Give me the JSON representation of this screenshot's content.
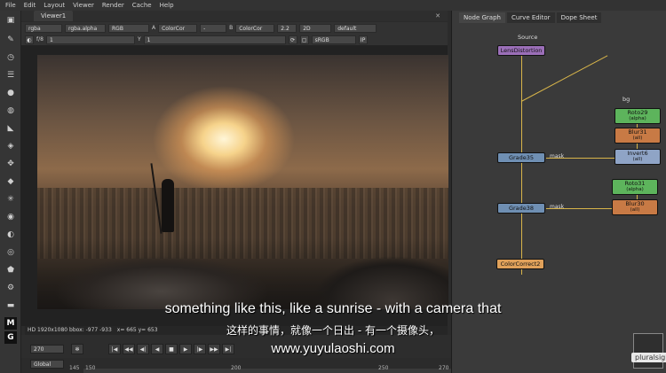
{
  "menu": [
    "File",
    "Edit",
    "Layout",
    "Viewer",
    "Render",
    "Cache",
    "Help"
  ],
  "viewer": {
    "tab_label": "Viewer1",
    "close_glyph": "✕",
    "channels": "rgba",
    "alpha_channel": "rgba.alpha",
    "display": "RGB",
    "a_label": "A",
    "a_input": "ColorCor",
    "dash": "-",
    "b_label": "B",
    "b_input": "ColorCor",
    "proxy": "2D",
    "gain_label": "2.2",
    "lut": "default",
    "f_label": "f/8",
    "f_value": "1",
    "y_label": "Y",
    "y_value": "1",
    "colorspace": "sRGB",
    "ip_label": "IP"
  },
  "status_line": {
    "format": "HD 1920x1080 bbox: -977 -933",
    "coords": "x= 665 y= 653"
  },
  "timeline": {
    "frame": "270",
    "scope": "Global",
    "ticks": [
      "145",
      "150",
      "200",
      "250",
      "270"
    ],
    "play_buttons": [
      "|◀",
      "◀◀",
      "◀|",
      "◀",
      "■",
      "▶",
      "|▶",
      "▶▶",
      "▶|"
    ]
  },
  "node_graph": {
    "tabs": [
      "Node Graph",
      "Curve Editor",
      "Dope Sheet"
    ],
    "source_label": "Source",
    "nodes": {
      "read": "LensDistortion",
      "grade35": "Grade35",
      "grade38": "Grade38",
      "colorcorrect": "ColorCorrect2",
      "roto29": "Roto29",
      "roto29_sub": "(alpha)",
      "blur31": "Blur31",
      "blur31_sub": "(all)",
      "invert6": "Invert6",
      "invert6_sub": "(all)",
      "roto31": "Roto31",
      "roto31_sub": "(alpha)",
      "blur30": "Blur30",
      "blur30_sub": "(all)"
    },
    "mask_label": "mask",
    "bg_label": "bg",
    "brand": "pluralsight"
  },
  "subtitles": {
    "english": "something like this, like a sunrise - with a camera that",
    "chinese": "这样的事情，就像一个日出 - 有一个摄像头，",
    "url": "www.yuyulaoshi.com"
  },
  "colors": {
    "accent_wire": "#d8b54a",
    "grade_node": "#6f8fb3",
    "roto_node": "#5db45c",
    "blur_node": "#c87a45"
  }
}
